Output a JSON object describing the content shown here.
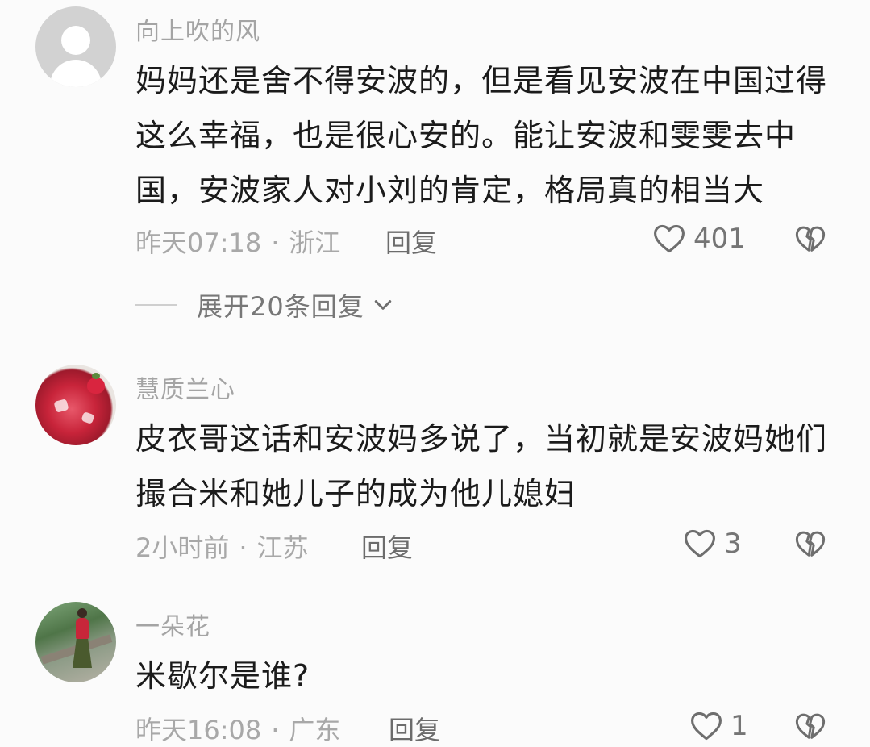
{
  "comments": [
    {
      "username": "向上吹的风",
      "avatar": "default-user-avatar",
      "text": "妈妈还是舍不得安波的，但是看见安波在中国过得这么幸福，也是很心安的。能让安波和雯雯去中国，安波家人对小刘的肯定，格局真的相当大",
      "time": "昨天07:18",
      "location": "浙江",
      "reply_label": "回复",
      "likes": "401",
      "expand_label": "展开20条回复"
    },
    {
      "username": "慧质兰心",
      "avatar": "drink-photo-avatar",
      "text": "皮衣哥这话和安波妈多说了，当初就是安波妈她们撮合米和她儿子的成为他儿媳妇",
      "time": "2小时前",
      "location": "江苏",
      "reply_label": "回复",
      "likes": "3"
    },
    {
      "username": "一朵花",
      "avatar": "garden-photo-avatar",
      "text": "米歇尔是谁?",
      "time": "昨天16:08",
      "location": "广东",
      "reply_label": "回复",
      "likes": "1"
    }
  ],
  "separator": "·",
  "icons": {
    "like": "heart-outline-icon",
    "dislike": "broken-heart-icon",
    "expand": "chevron-down-icon"
  },
  "colors": {
    "background": "#fbfbfb",
    "text": "#1b1b1b",
    "meta": "#a8a8a8",
    "icon": "#6e6e6e"
  }
}
